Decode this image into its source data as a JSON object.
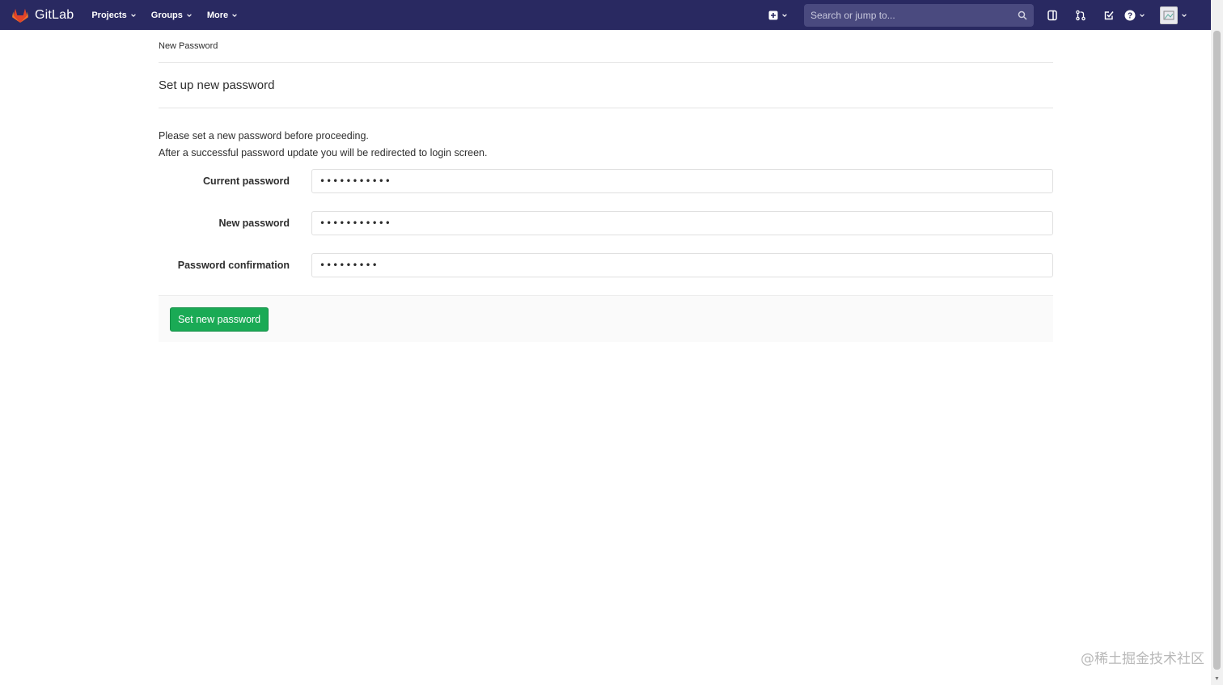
{
  "colors": {
    "navbar": "#292961",
    "search_bg": "#4a4a7f",
    "success": "#1aaa55",
    "logo_orange": "#e24329",
    "logo_orange_light": "#fc6d26",
    "logo_yellow": "#fca326"
  },
  "navbar": {
    "brand": "GitLab",
    "menu": [
      {
        "label": "Projects",
        "icon": "chevron-down-icon"
      },
      {
        "label": "Groups",
        "icon": "chevron-down-icon"
      },
      {
        "label": "More",
        "icon": "chevron-down-icon"
      }
    ],
    "search": {
      "placeholder": "Search or jump to..."
    },
    "icons": [
      "plus-square-icon",
      "search-icon",
      "sidebar-toggle-icon",
      "merge-request-icon",
      "todo-check-icon",
      "help-icon",
      "avatar"
    ]
  },
  "breadcrumb": "New Password",
  "page_title": "Set up new password",
  "intro": {
    "line1": "Please set a new password before proceeding.",
    "line2": "After a successful password update you will be redirected to login screen."
  },
  "form": {
    "current_password": {
      "label": "Current password",
      "value": "•••••••••••"
    },
    "new_password": {
      "label": "New password",
      "value": "•••••••••••"
    },
    "password_confirmation": {
      "label": "Password confirmation",
      "value": "•••••••••"
    },
    "submit_label": "Set new password"
  },
  "watermark": "@稀土掘金技术社区"
}
